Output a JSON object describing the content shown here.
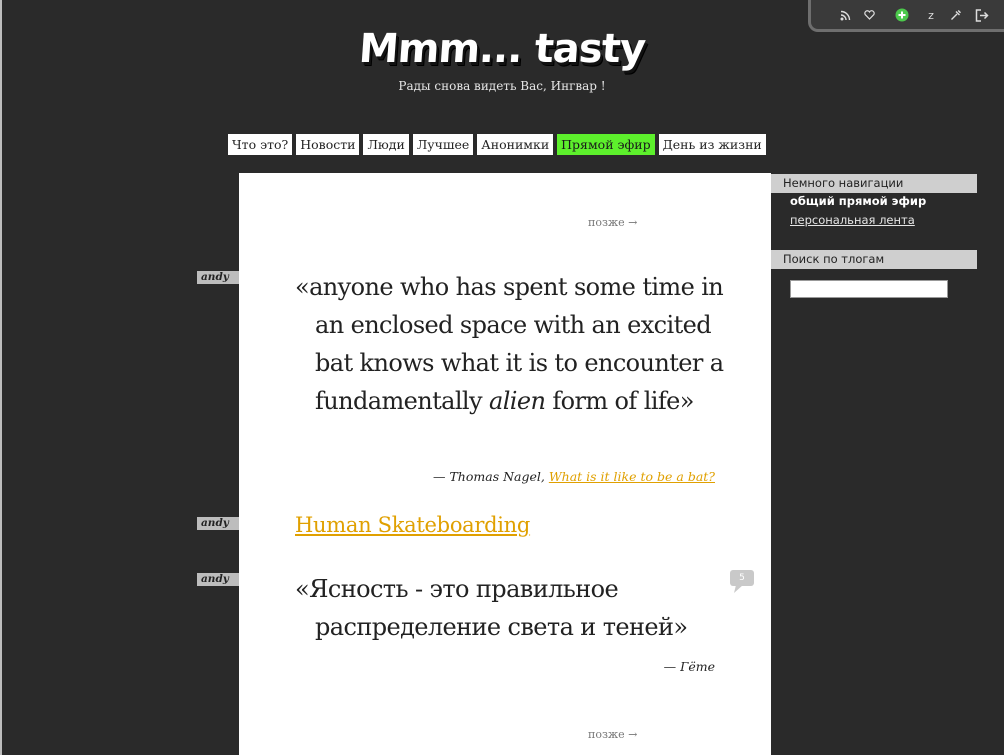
{
  "toolbar": {
    "icons": [
      "rss-icon",
      "heart-icon",
      "add-icon",
      "sleep-icon",
      "tools-icon",
      "logout-icon"
    ],
    "sleep_label": "z",
    "accent_color": "#4cc94c"
  },
  "header": {
    "logo_text": "Mmm... tasty",
    "greeting": "Рады снова видеть Вас,  Ингвар !"
  },
  "nav": {
    "items": [
      {
        "label": "Что это?"
      },
      {
        "label": "Новости"
      },
      {
        "label": "Люди"
      },
      {
        "label": "Лучшее"
      },
      {
        "label": "Анонимки"
      },
      {
        "label": "Прямой эфир"
      },
      {
        "label": "День из жизни"
      }
    ],
    "active": "Прямой эфир",
    "active_color": "#5df02c"
  },
  "pager": {
    "later_label": "позже →"
  },
  "posts": [
    {
      "author": "andy",
      "type": "quote",
      "open": "«",
      "text_before": "anyone who has spent some time in an enclosed space with an excited bat knows what it is to encounter a fundamentally ",
      "text_em": "alien",
      "text_after": " form of life",
      "close": "»",
      "cite_prefix": "— Thomas Nagel, ",
      "cite_link": "What is it like to be a bat?"
    },
    {
      "author": "andy",
      "type": "link",
      "link_text": "Human Skateboarding"
    },
    {
      "author": "andy",
      "type": "quote",
      "open": "«",
      "text": "Ясность - это правильное распределение света и теней",
      "close": "»",
      "cite": "— Гёте",
      "comments": "5"
    }
  ],
  "sidebar": {
    "nav_heading": "Немного навигации",
    "nav_current": "общий прямой эфир",
    "nav_link": "персональная лента",
    "search_heading": "Поиск по тлогам",
    "search_value": ""
  },
  "colors": {
    "background": "#2a2a2a",
    "link": "#e0a000",
    "sidebar_head": "#cfcfcf"
  }
}
